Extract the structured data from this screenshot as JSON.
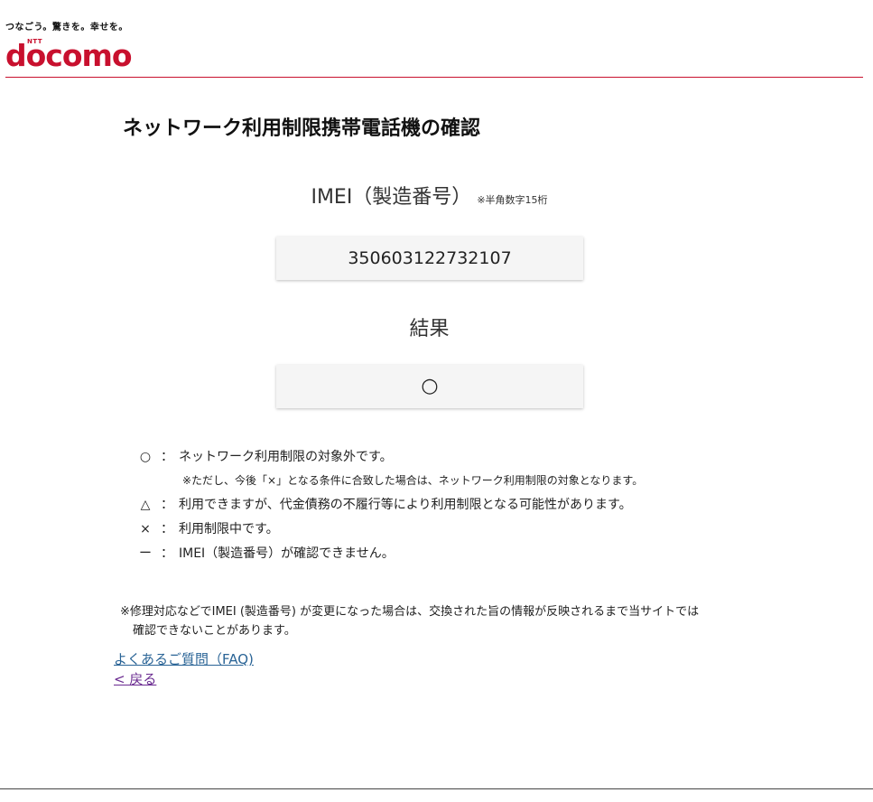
{
  "header": {
    "tagline": "つなごう。驚きを。幸せを。",
    "logo_small": "NTT",
    "logo_word": "docomo",
    "brand_color": "#c8102e"
  },
  "page_title": "ネットワーク利用制限携帯電話機の確認",
  "imei": {
    "heading": "IMEI（製造番号）",
    "note": "※半角数字15桁",
    "value": "350603122732107"
  },
  "result": {
    "heading": "結果",
    "value": "○"
  },
  "legend": [
    {
      "symbol": "○",
      "colon": "：",
      "text": "ネットワーク利用制限の対象外です。",
      "note": "※ただし、今後「×」となる条件に合致した場合は、ネットワーク利用制限の対象となります。"
    },
    {
      "symbol": "△",
      "colon": "：",
      "text": "利用できますが、代金債務の不履行等により利用制限となる可能性があります。"
    },
    {
      "symbol": "×",
      "colon": "：",
      "text": "利用制限中です。"
    },
    {
      "symbol": "ー",
      "colon": "：",
      "text": "IMEI（製造番号）が確認できません。"
    }
  ],
  "footnote": {
    "line1": "※修理対応などでIMEI (製造番号) が変更になった場合は、交換された旨の情報が反映されるまで当サイトでは",
    "line2": "確認できないことがあります。"
  },
  "links": {
    "faq": "よくあるご質問（FAQ)",
    "back": "< 戻る"
  }
}
